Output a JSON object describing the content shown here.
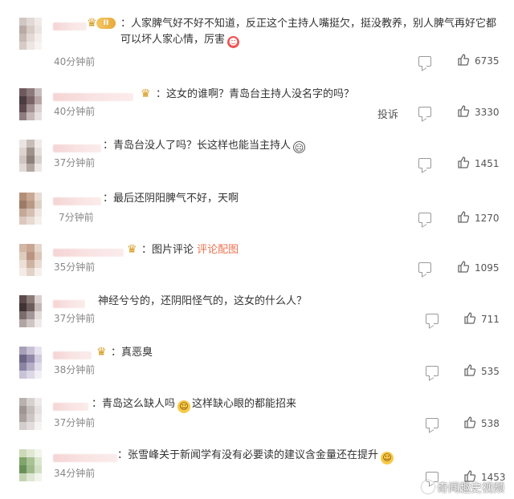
{
  "comments": [
    {
      "text": "：人家脾气好不好不知道，反正这个主持人嘴挺欠，挺没教养，别人脾气再好它都可以坏人家心情，厉害",
      "time": "40分钟前",
      "likes": "6735",
      "badge": "II"
    },
    {
      "text": "：这女的谁啊？青岛台主持人没名字的吗？",
      "time": "40分钟前",
      "likes": "3330",
      "report": "投诉"
    },
    {
      "text": "：青岛台没人了吗？长这样也能当主持人",
      "time": "37分钟前",
      "likes": "1451"
    },
    {
      "text": "：最后还阴阳脾气不好，天啊",
      "time": "7分钟前",
      "likes": "1270"
    },
    {
      "text": "：图片评论",
      "link": "评论配图",
      "time": "35分钟前",
      "likes": "1095"
    },
    {
      "text": "神经兮兮的，还阴阳怪气的，这女的什么人？",
      "time": "37分钟前",
      "likes": "711"
    },
    {
      "text": "：真恶臭",
      "time": "38分钟前",
      "likes": "535"
    },
    {
      "text": "：青岛这么缺人吗",
      "text_after": "这样缺心眼的都能招来",
      "time": "37分钟前",
      "likes": "538"
    },
    {
      "text": "：张雪峰关于新闻学有没有必要读的建议含金量还在提升",
      "time": "34分钟前",
      "likes": "1453"
    }
  ],
  "watermark": "奇闻趣史视频",
  "colors": {
    "link": "#eb7350",
    "crown": "#d59a1c",
    "muted": "#888888"
  }
}
